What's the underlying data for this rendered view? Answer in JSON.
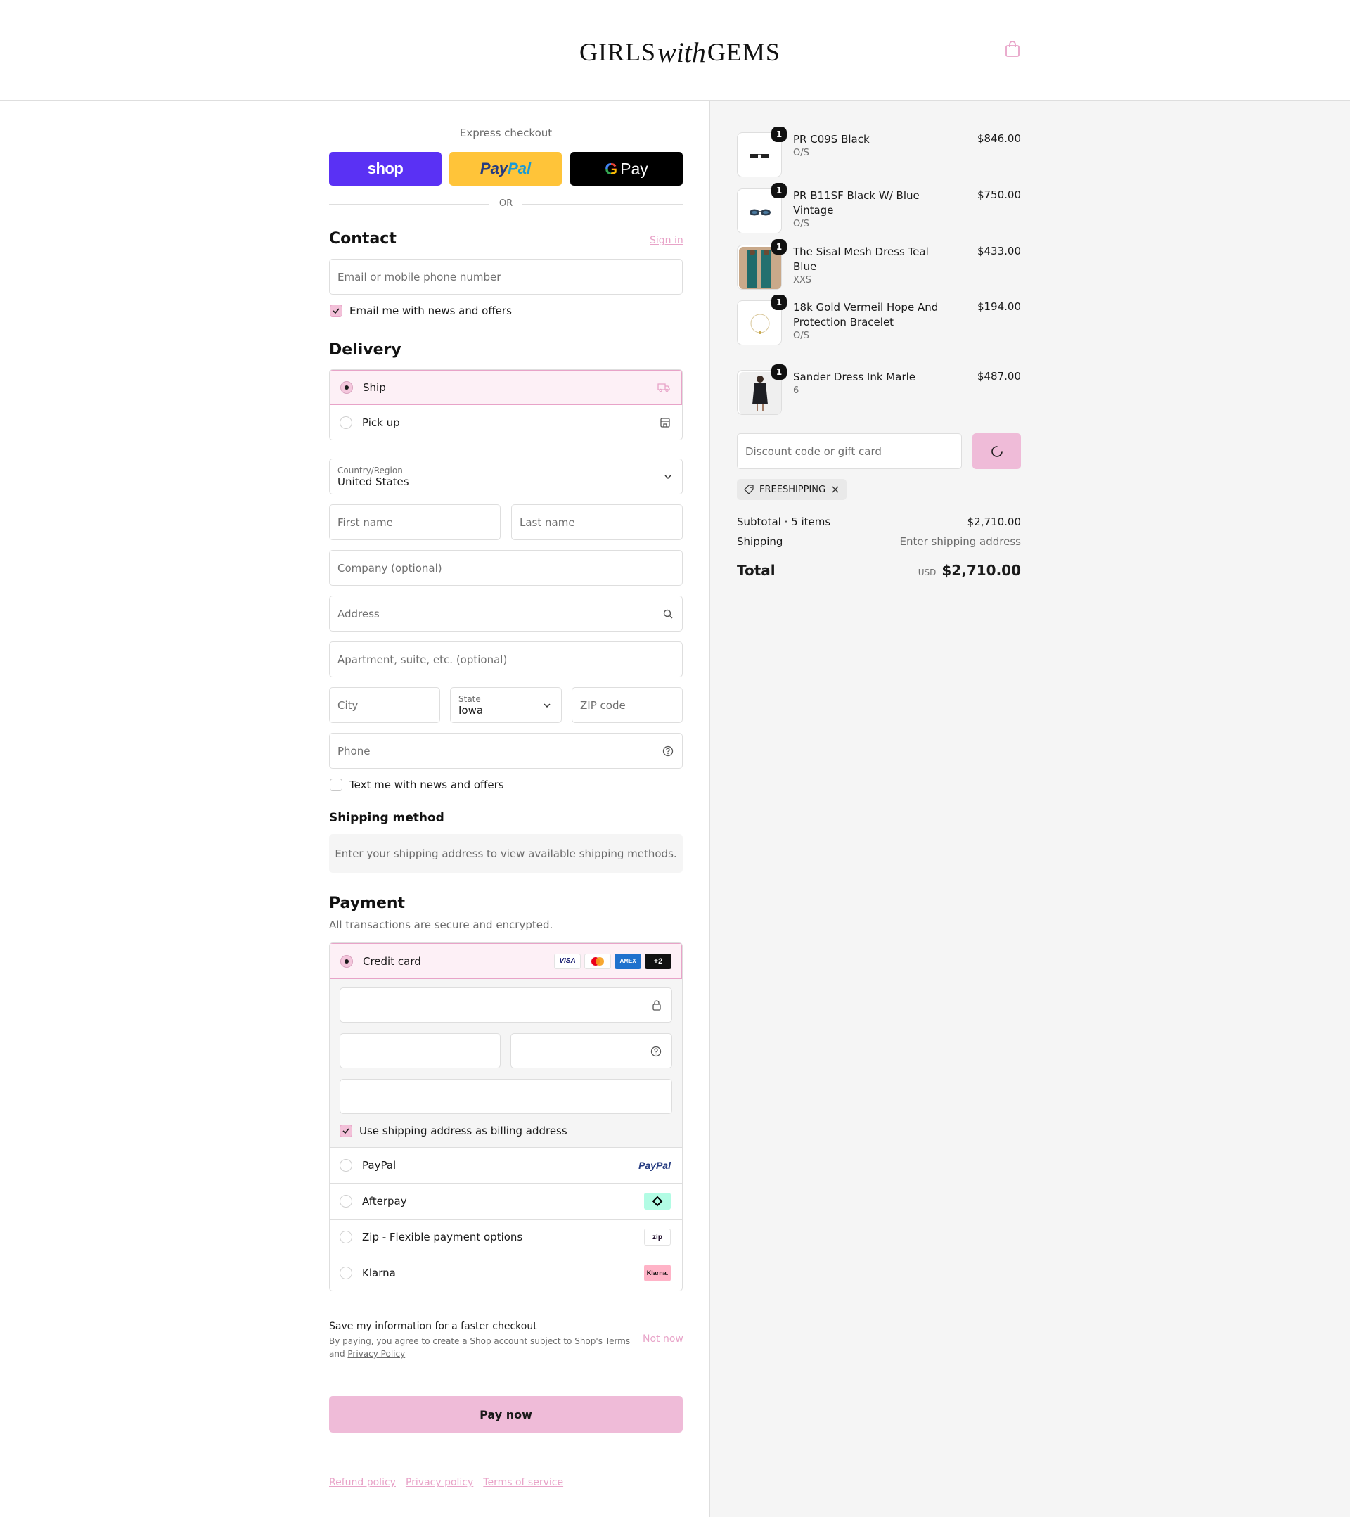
{
  "header": {
    "logo_part1": "GIRLS",
    "logo_part2": "with",
    "logo_part3": "GEMS",
    "cart_icon": "shopping-bag-icon"
  },
  "express": {
    "title": "Express checkout",
    "shop_label": "shop",
    "paypal_label_a": "Pay",
    "paypal_label_b": "Pal",
    "gpay_g": "G",
    "gpay_label": "Pay",
    "or": "OR"
  },
  "contact": {
    "heading": "Contact",
    "sign_in": "Sign in",
    "email_placeholder": "Email or mobile phone number",
    "news_label": "Email me with news and offers",
    "news_checked": true
  },
  "delivery": {
    "heading": "Delivery",
    "options": [
      {
        "label": "Ship",
        "selected": true,
        "icon": "truck-icon"
      },
      {
        "label": "Pick up",
        "selected": false,
        "icon": "store-icon"
      }
    ],
    "country_label": "Country/Region",
    "country_value": "United States",
    "first_name": "First name",
    "last_name": "Last name",
    "company": "Company (optional)",
    "address": "Address",
    "apartment": "Apartment, suite, etc. (optional)",
    "city": "City",
    "state_label": "State",
    "state_value": "Iowa",
    "zip": "ZIP code",
    "phone": "Phone",
    "text_label": "Text me with news and offers",
    "text_checked": false
  },
  "shipping_method": {
    "heading": "Shipping method",
    "message": "Enter your shipping address to view available shipping methods."
  },
  "payment": {
    "heading": "Payment",
    "subtitle": "All transactions are secure and encrypted.",
    "credit_card_label": "Credit card",
    "card_logos": [
      "VISA",
      "mastercard",
      "AMEX",
      "+2"
    ],
    "billing_label": "Use shipping address as billing address",
    "billing_checked": true,
    "methods": [
      {
        "label": "PayPal",
        "logo": "PayPal"
      },
      {
        "label": "Afterpay",
        "logo": "afterpay-icon"
      },
      {
        "label": "Zip - Flexible payment options",
        "logo": "zip"
      },
      {
        "label": "Klarna",
        "logo": "Klarna."
      }
    ]
  },
  "save": {
    "title": "Save my information for a faster checkout",
    "text_a": "By paying, you agree to create a Shop account subject to Shop's",
    "terms": "Terms",
    "and": "and",
    "privacy": "Privacy Policy",
    "not_now": "Not now"
  },
  "pay_button": "Pay now",
  "footer_links": [
    "Refund policy",
    "Privacy policy",
    "Terms of service"
  ],
  "summary": {
    "items": [
      {
        "name": "PR C09S Black",
        "variant": "O/S",
        "price": "$846.00",
        "qty": "1"
      },
      {
        "name": "PR B11SF Black W/ Blue Vintage",
        "variant": "O/S",
        "price": "$750.00",
        "qty": "1"
      },
      {
        "name": "The Sisal Mesh Dress Teal Blue",
        "variant": "XXS",
        "price": "$433.00",
        "qty": "1"
      },
      {
        "name": "18k Gold Vermeil Hope And Protection Bracelet",
        "variant": "O/S",
        "price": "$194.00",
        "qty": "1"
      },
      {
        "name": "Sander Dress Ink Marle",
        "variant": "6",
        "price": "$487.00",
        "qty": "1"
      }
    ],
    "discount_placeholder": "Discount code or gift card",
    "applied_code": "FREESHIPPING",
    "subtotal_label": "Subtotal · 5 items",
    "subtotal_value": "$2,710.00",
    "shipping_label": "Shipping",
    "shipping_value": "Enter shipping address",
    "total_label": "Total",
    "currency": "USD",
    "total_value": "$2,710.00"
  },
  "colors": {
    "accent_pink": "#efbbd8",
    "link_pink": "#e8a3c8",
    "shop_purple": "#5a31f4",
    "paypal_yellow": "#ffc439"
  }
}
